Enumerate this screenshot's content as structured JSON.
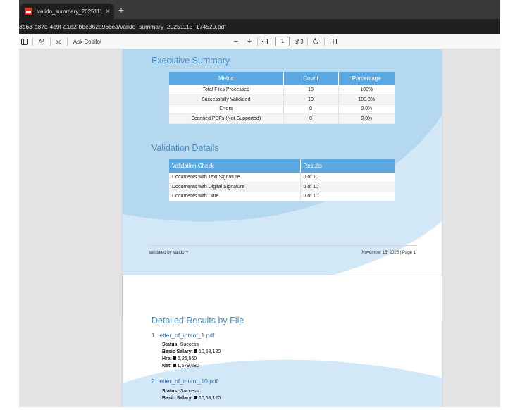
{
  "browser": {
    "tab": {
      "title": "valido_summary_20251115_17452",
      "close": "×"
    },
    "new_tab": "+",
    "address": "3d63-a87d-4e9f-a1e2-bbe362a96cea/valido_summary_20251115_174520.pdf"
  },
  "pdf_toolbar": {
    "sidebar_icon": "sidebar-icon",
    "read_aloud": "Aᴬ",
    "translate": "aə",
    "ask_copilot": "Ask Copilot",
    "zoom_out": "−",
    "zoom_in": "+",
    "fit_icon": "fit-page-icon",
    "page_number": "1",
    "page_total": "of 3",
    "rotate_icon": "rotate-icon",
    "two_page_icon": "two-page-view-icon"
  },
  "page1": {
    "executive_summary": {
      "title": "Executive Summary",
      "headers": [
        "Metric",
        "Count",
        "Percentage"
      ],
      "rows": [
        [
          "Total Files Processed",
          "10",
          "100%"
        ],
        [
          "Successfully Validated",
          "10",
          "100.0%"
        ],
        [
          "Errors",
          "0",
          "0.0%"
        ],
        [
          "Scanned PDFs (Not Supported)",
          "0",
          "0.0%"
        ]
      ]
    },
    "validation_details": {
      "title": "Validation Details",
      "headers": [
        "Validation Check",
        "Results"
      ],
      "rows": [
        [
          "Documents with Text Signature",
          "0 of 10"
        ],
        [
          "Documents with Digital Signature",
          "0 of 10"
        ],
        [
          "Documents with Date",
          "0 of 10"
        ]
      ]
    },
    "footer": {
      "left": "Validated by Valido™",
      "right": "November 15, 2025 | Page 1"
    }
  },
  "page2": {
    "title": "Detailed Results by File",
    "files": [
      {
        "heading": "1. letter_of_intent_1.pdf",
        "status_label": "Status:",
        "status": "Success",
        "salary_label": "Basic Salary:",
        "salary": "10,53,120",
        "hra_label": "Hra:",
        "hra": "5,26,560",
        "net_label": "Net:",
        "net": "1,579,680"
      },
      {
        "heading": "2. letter_of_intent_10.pdf",
        "status_label": "Status:",
        "status": "Success",
        "salary_label": "Basic Salary:",
        "salary": "10,53,120"
      }
    ]
  },
  "colors": {
    "accent": "#4a90c8",
    "table_header": "#5aa9e2",
    "wave_light": "#d3e8f7",
    "wave_mid": "#b5d8f1"
  }
}
